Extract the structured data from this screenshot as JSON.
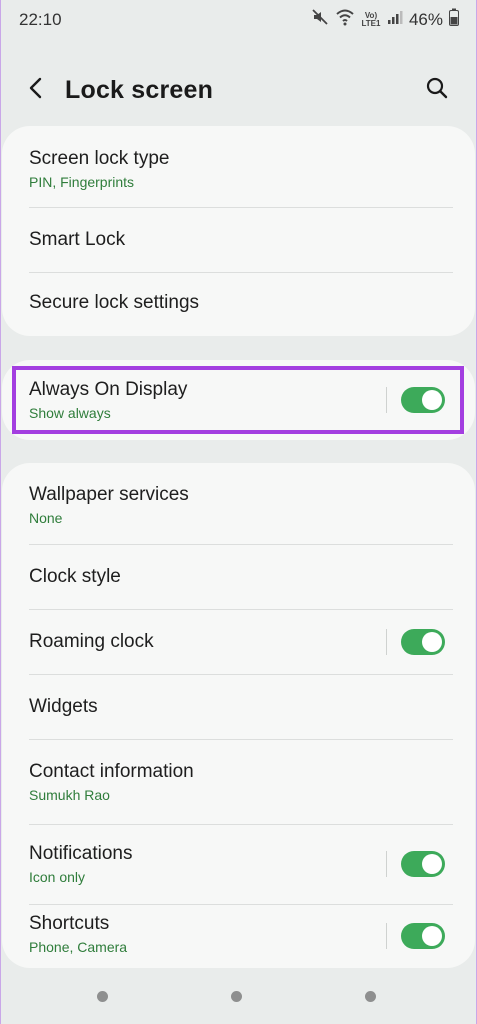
{
  "status_bar": {
    "time": "22:10",
    "battery": "46%",
    "network_label": "Vo) LTE1",
    "icons": [
      "mute-icon",
      "wifi-icon",
      "volte-icon",
      "signal-icon",
      "battery-icon"
    ]
  },
  "header": {
    "title": "Lock screen",
    "back_icon": "back-arrow-icon",
    "search_icon": "search-icon"
  },
  "sections": {
    "security": {
      "items": [
        {
          "title": "Screen lock type",
          "subtitle": "PIN, Fingerprints"
        },
        {
          "title": "Smart Lock"
        },
        {
          "title": "Secure lock settings"
        }
      ]
    },
    "aod": {
      "title": "Always On Display",
      "subtitle": "Show always",
      "toggle_on": true
    },
    "customize": {
      "items": [
        {
          "title": "Wallpaper services",
          "subtitle": "None"
        },
        {
          "title": "Clock style"
        },
        {
          "title": "Roaming clock",
          "toggle_on": true
        },
        {
          "title": "Widgets"
        },
        {
          "title": "Contact information",
          "subtitle": "Sumukh Rao"
        },
        {
          "title": "Notifications",
          "subtitle": "Icon only",
          "toggle_on": true
        },
        {
          "title": "Shortcuts",
          "subtitle": "Phone, Camera",
          "toggle_on": true
        }
      ]
    }
  },
  "colors": {
    "background": "#e9eceb",
    "card": "#f7f8f7",
    "accent_green": "#3daa5a",
    "subtitle_green": "#2f7d3b",
    "highlight_purple": "#a33ee0"
  }
}
